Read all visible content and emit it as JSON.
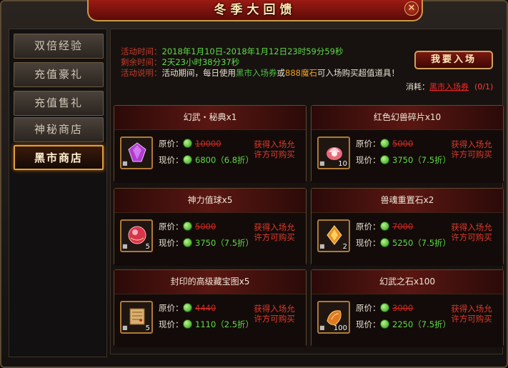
{
  "window": {
    "title": "冬季大回馈",
    "close_glyph": "✕"
  },
  "sidebar": {
    "items": [
      {
        "label": "双倍经验"
      },
      {
        "label": "充值豪礼"
      },
      {
        "label": "充值售礼"
      },
      {
        "label": "神秘商店"
      },
      {
        "label": "黑市商店",
        "active": true
      }
    ]
  },
  "info": {
    "time_label": "活动时间：",
    "time_value": "2018年1月10日-2018年1月12日23时59分59秒",
    "remain_label": "剩余时间：",
    "remain_value": "2天23小时38分37秒",
    "desc_label": "活动说明：",
    "desc_prefix": "活动期间，每日使用",
    "desc_ticket": "黑市入场券",
    "desc_or": "或",
    "desc_ore": "888魔石",
    "desc_suffix": "可入场购买超值道具！"
  },
  "enter_button": {
    "label": "我要入场"
  },
  "consume": {
    "label": "消耗：",
    "ticket": "黑市入场券",
    "count": "(0/1)"
  },
  "price_labels": {
    "original": "原价：",
    "current": "现价："
  },
  "need_text": "获得入场允许方可购买",
  "items": [
    {
      "name": "幻武・秘典x1",
      "qty": "",
      "original": "10000",
      "current": "6800（6.8折）",
      "icon": "purple-gem-icon",
      "color": "#b03cd0"
    },
    {
      "name": "红色幻兽碎片x10",
      "qty": "10",
      "original": "5000",
      "current": "3750（7.5折）",
      "icon": "lotus-shard-icon",
      "color": "#e86a7a"
    },
    {
      "name": "神力值球x5",
      "qty": "5",
      "original": "5000",
      "current": "3750（7.5折）",
      "icon": "power-orb-icon",
      "color": "#d8344a"
    },
    {
      "name": "兽魂重置石x2",
      "qty": "2",
      "original": "7000",
      "current": "5250（7.5折）",
      "icon": "beast-stone-icon",
      "color": "#e89020"
    },
    {
      "name": "封印的高级藏宝图x5",
      "qty": "5",
      "original": "4440",
      "current": "1110（2.5折）",
      "icon": "treasure-map-icon",
      "color": "#d8b070"
    },
    {
      "name": "幻武之石x100",
      "qty": "100",
      "original": "3000",
      "current": "2250（7.5折）",
      "icon": "phantom-stone-icon",
      "color": "#e07a20"
    }
  ]
}
